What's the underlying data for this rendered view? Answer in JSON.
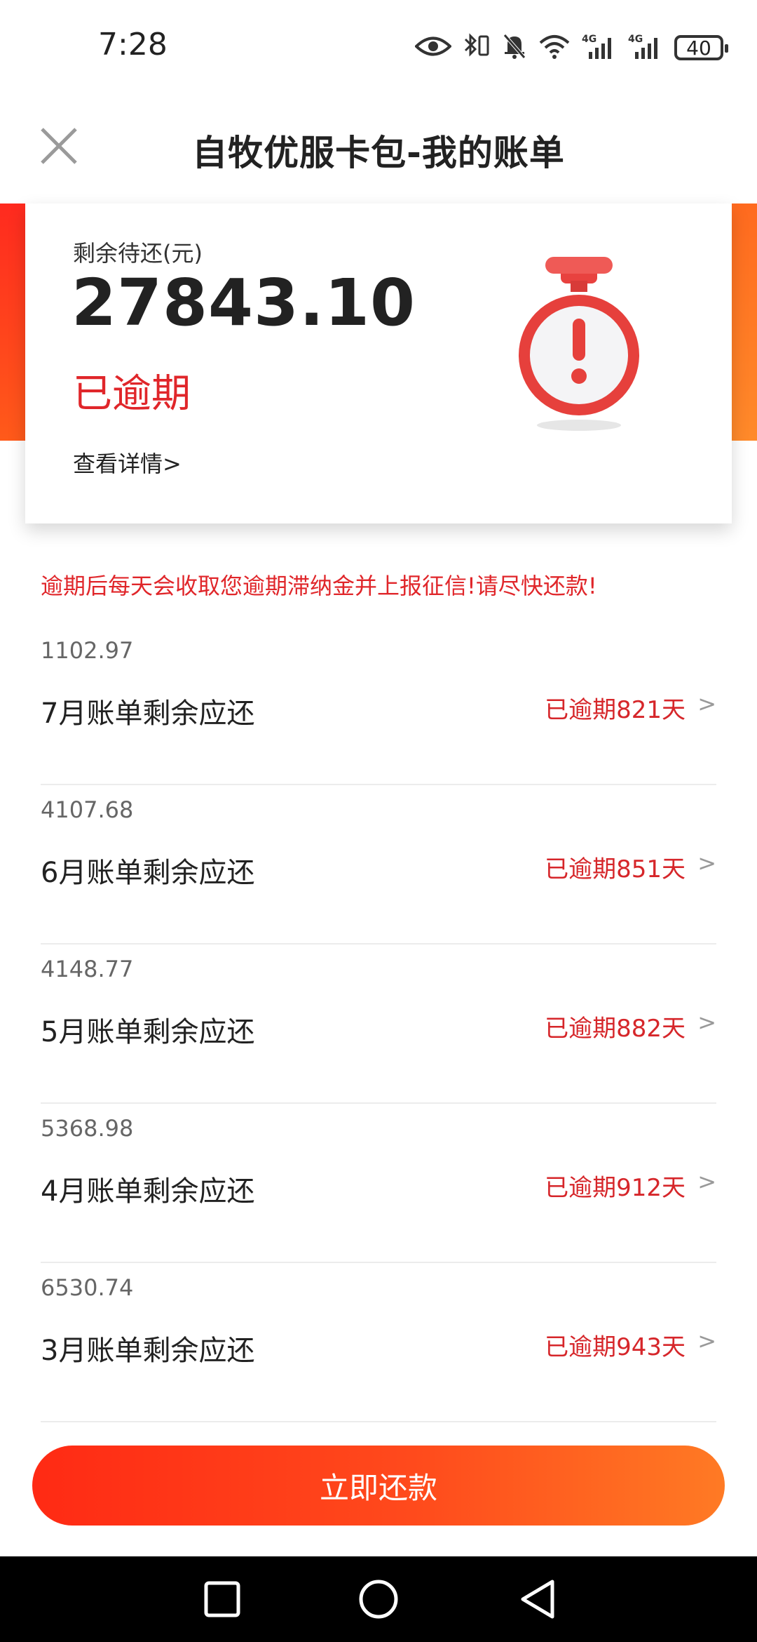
{
  "status_bar": {
    "time": "7:28",
    "battery": "40",
    "network_1": "4G",
    "network_2": "4G"
  },
  "header": {
    "title": "自牧优服卡包-我的账单",
    "close_icon": "close-icon"
  },
  "summary": {
    "remaining_label": "剩余待还(元)",
    "remaining_amount": "27843.10",
    "status": "已逾期",
    "details_link": "查看详情>",
    "illustration": "stopwatch-alert-icon"
  },
  "warning": "逾期后每天会收取您逾期滞纳金并上报征信!请尽快还款!",
  "bills": [
    {
      "amount": "1102.97",
      "label": "7月账单剩余应还",
      "status": "已逾期821天",
      "chevron": ">"
    },
    {
      "amount": "4107.68",
      "label": "6月账单剩余应还",
      "status": "已逾期851天",
      "chevron": ">"
    },
    {
      "amount": "4148.77",
      "label": "5月账单剩余应还",
      "status": "已逾期882天",
      "chevron": ">"
    },
    {
      "amount": "5368.98",
      "label": "4月账单剩余应还",
      "status": "已逾期912天",
      "chevron": ">"
    },
    {
      "amount": "6530.74",
      "label": "3月账单剩余应还",
      "status": "已逾期943天",
      "chevron": ">"
    }
  ],
  "pay_button": "立即还款",
  "colors": {
    "accent_red": "#e0262a",
    "button_gradient_start": "#ff2a14",
    "button_gradient_end": "#ff7a24"
  }
}
